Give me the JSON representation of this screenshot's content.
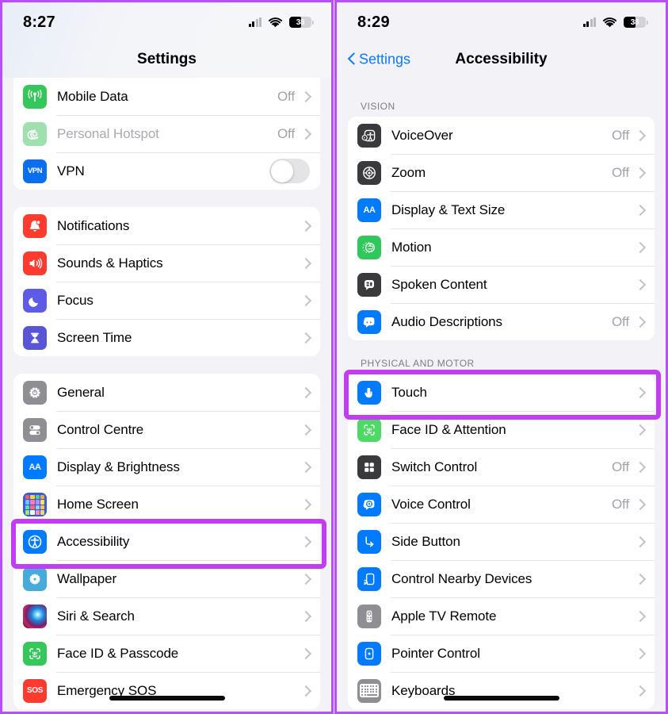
{
  "theme": {
    "highlight_color": "#c13df0",
    "accent_blue": "#0a7aff",
    "page_background": "#f2f2f7",
    "card_background": "#ffffff",
    "value_gray": "#a2a2a8"
  },
  "left_phone": {
    "status_bar": {
      "time": "8:27",
      "battery_percent": "38",
      "signal_icon": "cellular-bars-icon",
      "wifi_icon": "wifi-icon",
      "battery_icon": "battery-icon"
    },
    "nav": {
      "title": "Settings"
    },
    "groups": [
      {
        "name": "connectivity",
        "header": "",
        "rows": [
          {
            "icon": "mobile-data-icon",
            "label": "Mobile Data",
            "value": "Off",
            "accessory": "chevron",
            "dim": false
          },
          {
            "icon": "personal-hotspot-icon",
            "label": "Personal Hotspot",
            "value": "Off",
            "accessory": "chevron",
            "dim": true
          },
          {
            "icon": "vpn-icon",
            "label": "VPN",
            "value": "",
            "accessory": "toggle",
            "dim": false
          }
        ]
      },
      {
        "name": "alerts",
        "header": "",
        "rows": [
          {
            "icon": "notifications-icon",
            "label": "Notifications",
            "value": "",
            "accessory": "chevron",
            "dim": false
          },
          {
            "icon": "sounds-haptics-icon",
            "label": "Sounds & Haptics",
            "value": "",
            "accessory": "chevron",
            "dim": false
          },
          {
            "icon": "focus-icon",
            "label": "Focus",
            "value": "",
            "accessory": "chevron",
            "dim": false
          },
          {
            "icon": "screen-time-icon",
            "label": "Screen Time",
            "value": "",
            "accessory": "chevron",
            "dim": false
          }
        ]
      },
      {
        "name": "system",
        "header": "",
        "rows": [
          {
            "icon": "general-gear-icon",
            "label": "General",
            "value": "",
            "accessory": "chevron",
            "dim": false
          },
          {
            "icon": "control-centre-icon",
            "label": "Control Centre",
            "value": "",
            "accessory": "chevron",
            "dim": false
          },
          {
            "icon": "display-brightness-icon",
            "label": "Display & Brightness",
            "value": "",
            "accessory": "chevron",
            "dim": false
          },
          {
            "icon": "home-screen-icon",
            "label": "Home Screen",
            "value": "",
            "accessory": "chevron",
            "dim": false
          },
          {
            "icon": "accessibility-icon",
            "label": "Accessibility",
            "value": "",
            "accessory": "chevron",
            "dim": false
          },
          {
            "icon": "wallpaper-icon",
            "label": "Wallpaper",
            "value": "",
            "accessory": "chevron",
            "dim": false
          },
          {
            "icon": "siri-search-icon",
            "label": "Siri & Search",
            "value": "",
            "accessory": "chevron",
            "dim": false
          },
          {
            "icon": "face-id-passcode-icon",
            "label": "Face ID & Passcode",
            "value": "",
            "accessory": "chevron",
            "dim": false
          },
          {
            "icon": "emergency-sos-icon",
            "label": "Emergency SOS",
            "value": "",
            "accessory": "chevron",
            "dim": false
          }
        ]
      }
    ],
    "highlight": {
      "target_label": "Accessibility"
    }
  },
  "right_phone": {
    "status_bar": {
      "time": "8:29",
      "battery_percent": "38",
      "signal_icon": "cellular-bars-icon",
      "wifi_icon": "wifi-icon",
      "battery_icon": "battery-icon"
    },
    "nav": {
      "back_label": "Settings",
      "title": "Accessibility"
    },
    "groups": [
      {
        "name": "vision",
        "header": "VISION",
        "rows": [
          {
            "icon": "voiceover-icon",
            "label": "VoiceOver",
            "value": "Off",
            "accessory": "chevron",
            "dim": false
          },
          {
            "icon": "zoom-icon",
            "label": "Zoom",
            "value": "Off",
            "accessory": "chevron",
            "dim": false
          },
          {
            "icon": "display-text-size-icon",
            "label": "Display & Text Size",
            "value": "",
            "accessory": "chevron",
            "dim": false
          },
          {
            "icon": "motion-icon",
            "label": "Motion",
            "value": "",
            "accessory": "chevron",
            "dim": false
          },
          {
            "icon": "spoken-content-icon",
            "label": "Spoken Content",
            "value": "",
            "accessory": "chevron",
            "dim": false
          },
          {
            "icon": "audio-descriptions-icon",
            "label": "Audio Descriptions",
            "value": "Off",
            "accessory": "chevron",
            "dim": false
          }
        ]
      },
      {
        "name": "physical_and_motor",
        "header": "PHYSICAL AND MOTOR",
        "rows": [
          {
            "icon": "touch-icon",
            "label": "Touch",
            "value": "",
            "accessory": "chevron",
            "dim": false
          },
          {
            "icon": "face-id-attention-icon",
            "label": "Face ID & Attention",
            "value": "",
            "accessory": "chevron",
            "dim": false
          },
          {
            "icon": "switch-control-icon",
            "label": "Switch Control",
            "value": "Off",
            "accessory": "chevron",
            "dim": false
          },
          {
            "icon": "voice-control-icon",
            "label": "Voice Control",
            "value": "Off",
            "accessory": "chevron",
            "dim": false
          },
          {
            "icon": "side-button-icon",
            "label": "Side Button",
            "value": "",
            "accessory": "chevron",
            "dim": false
          },
          {
            "icon": "control-nearby-devices-icon",
            "label": "Control Nearby Devices",
            "value": "",
            "accessory": "chevron",
            "dim": false
          },
          {
            "icon": "apple-tv-remote-icon",
            "label": "Apple TV Remote",
            "value": "",
            "accessory": "chevron",
            "dim": false
          },
          {
            "icon": "pointer-control-icon",
            "label": "Pointer Control",
            "value": "",
            "accessory": "chevron",
            "dim": false
          },
          {
            "icon": "keyboards-icon",
            "label": "Keyboards",
            "value": "",
            "accessory": "chevron",
            "dim": false
          }
        ]
      }
    ],
    "highlight": {
      "target_label": "Touch"
    }
  }
}
